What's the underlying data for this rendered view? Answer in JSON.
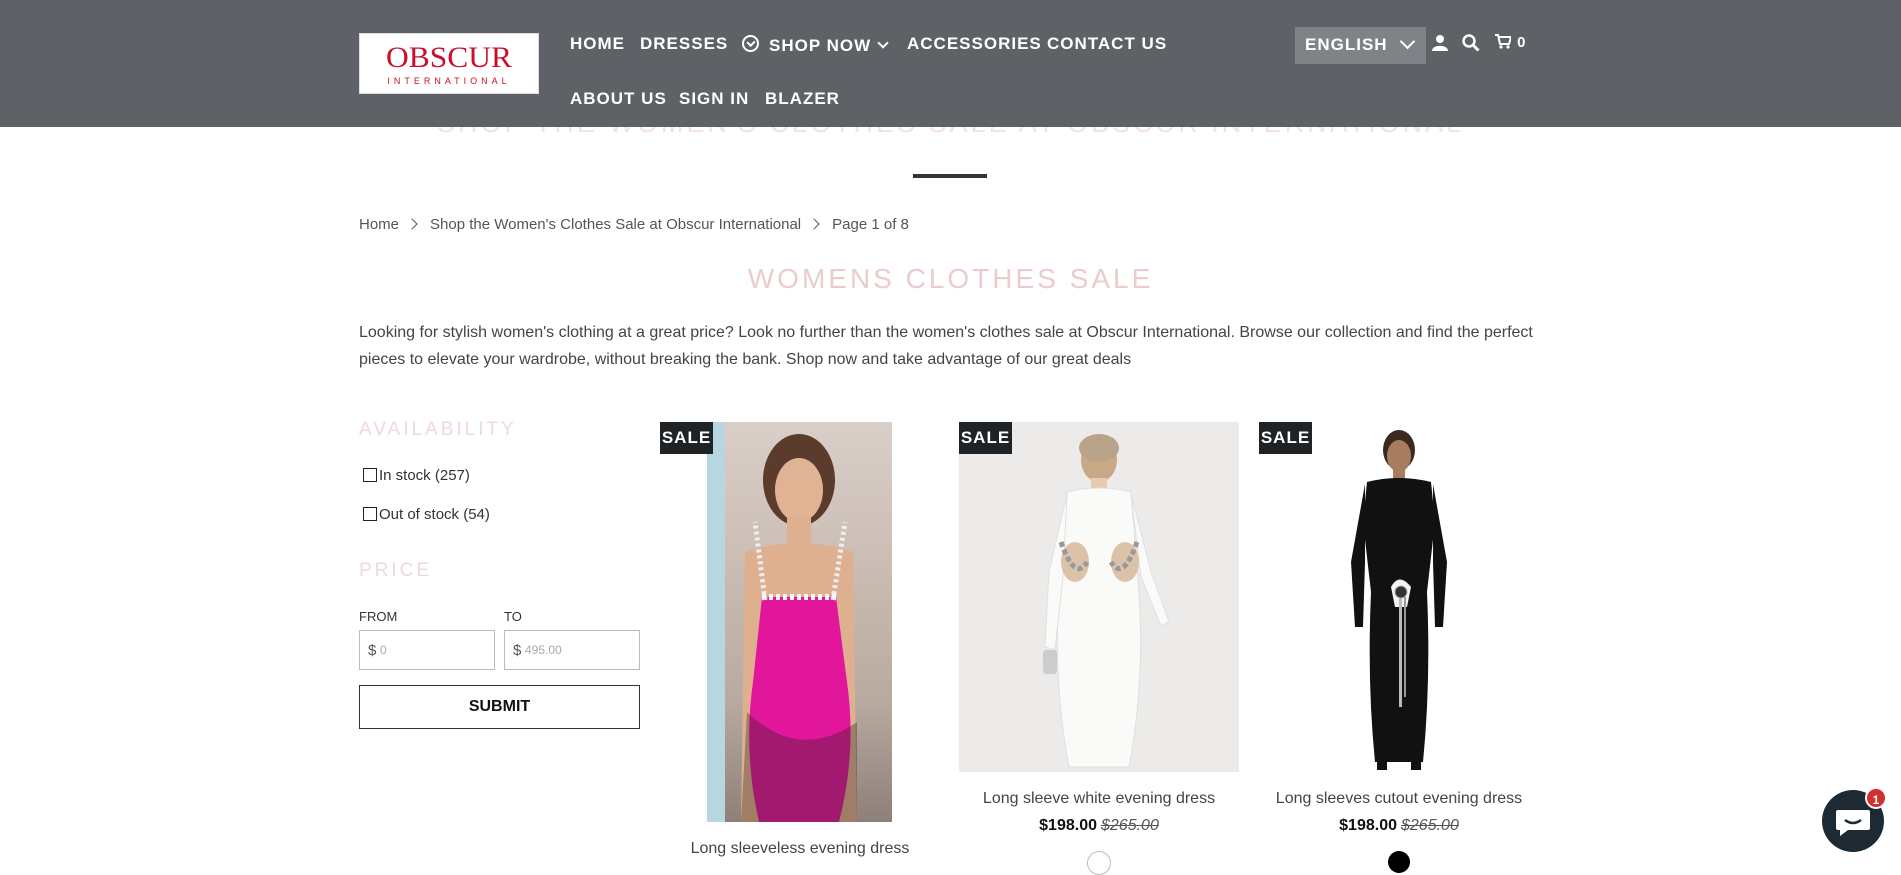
{
  "header": {
    "logo": {
      "line1": "OBSCUR",
      "line2": "INTERNATIONAL"
    },
    "nav": [
      "HOME",
      "DRESSES",
      "SHOP NOW",
      "ACCESSORIES",
      "CONTACT US",
      "ABOUT US",
      "SIGN IN",
      "BLAZER"
    ],
    "language": "ENGLISH",
    "cart_count": "0"
  },
  "page": {
    "ghost_title": "SHOP THE WOMEN'S CLOTHES SALE AT OBSCUR INTERNATIONAL",
    "breadcrumb": {
      "home": "Home",
      "collection": "Shop the Women's Clothes Sale at Obscur International",
      "page": "Page 1 of 8"
    },
    "title": "WOMENS CLOTHES SALE",
    "description": "Looking for stylish women's clothing at a great price? Look no further than the women's clothes sale at Obscur International. Browse our collection and find the perfect pieces to elevate your wardrobe, without breaking the bank. Shop now and take advantage of our great deals"
  },
  "filters": {
    "availability_heading": "AVAILABILITY",
    "in_stock": "In stock (257)",
    "out_of_stock": "Out of stock (54)",
    "price_heading": "PRICE",
    "from_label": "FROM",
    "to_label": "TO",
    "currency": "$",
    "from_placeholder": "0",
    "to_placeholder": "495.00",
    "submit": "SUBMIT"
  },
  "products": [
    {
      "badge": "SALE",
      "name": "Long sleeveless evening dress",
      "price": "",
      "compare": "",
      "dress_color": "#e2169b"
    },
    {
      "badge": "SALE",
      "name": "Long sleeve white evening dress",
      "price": "$198.00",
      "compare": "$265.00",
      "dress_color": "#f7f7f5",
      "swatch": "#ffffff"
    },
    {
      "badge": "SALE",
      "name": "Long sleeves cutout evening dress",
      "price": "$198.00",
      "compare": "$265.00",
      "dress_color": "#111111",
      "swatch": "#000000"
    }
  ],
  "chat": {
    "unread": "1"
  }
}
